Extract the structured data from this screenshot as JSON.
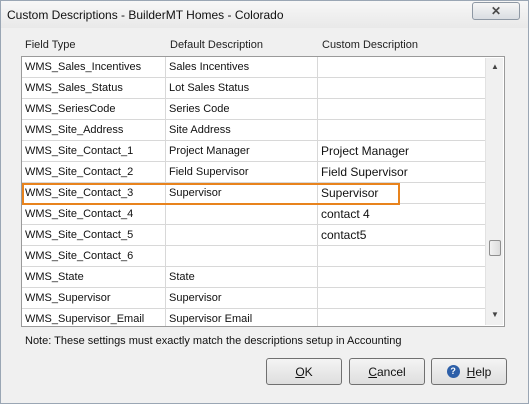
{
  "window": {
    "title": "Custom Descriptions - BuilderMT Homes - Colorado",
    "close_glyph": "✕"
  },
  "columns": [
    "Field Type",
    "Default Description",
    "Custom Description"
  ],
  "rows": [
    {
      "field_type": "WMS_Sales_Incentives",
      "default": "Sales Incentives",
      "custom": ""
    },
    {
      "field_type": "WMS_Sales_Status",
      "default": "Lot Sales Status",
      "custom": ""
    },
    {
      "field_type": "WMS_SeriesCode",
      "default": "Series Code",
      "custom": ""
    },
    {
      "field_type": "WMS_Site_Address",
      "default": "Site Address",
      "custom": ""
    },
    {
      "field_type": "WMS_Site_Contact_1",
      "default": "Project Manager",
      "custom": "Project Manager"
    },
    {
      "field_type": "WMS_Site_Contact_2",
      "default": "Field Supervisor",
      "custom": "Field Supervisor"
    },
    {
      "field_type": "WMS_Site_Contact_3",
      "default": "Supervisor",
      "custom": "Supervisor"
    },
    {
      "field_type": "WMS_Site_Contact_4",
      "default": "",
      "custom": "contact 4"
    },
    {
      "field_type": "WMS_Site_Contact_5",
      "default": "",
      "custom": "contact5"
    },
    {
      "field_type": "WMS_Site_Contact_6",
      "default": "",
      "custom": ""
    },
    {
      "field_type": "WMS_State",
      "default": "State",
      "custom": ""
    },
    {
      "field_type": "WMS_Supervisor",
      "default": "Supervisor",
      "custom": ""
    },
    {
      "field_type": "WMS_Supervisor_Email",
      "default": "Supervisor Email",
      "custom": ""
    }
  ],
  "highlight_color": "#e8831d",
  "note": "Note: These settings must exactly match the descriptions setup in  Accounting",
  "buttons": {
    "ok_mnemonic": "O",
    "ok_rest": "K",
    "cancel_mnemonic": "C",
    "cancel_rest": "ancel",
    "help_mnemonic": "H",
    "help_rest": "elp",
    "help_icon_glyph": "?"
  },
  "scrollbar": {
    "up_glyph": "▲",
    "down_glyph": "▼"
  }
}
